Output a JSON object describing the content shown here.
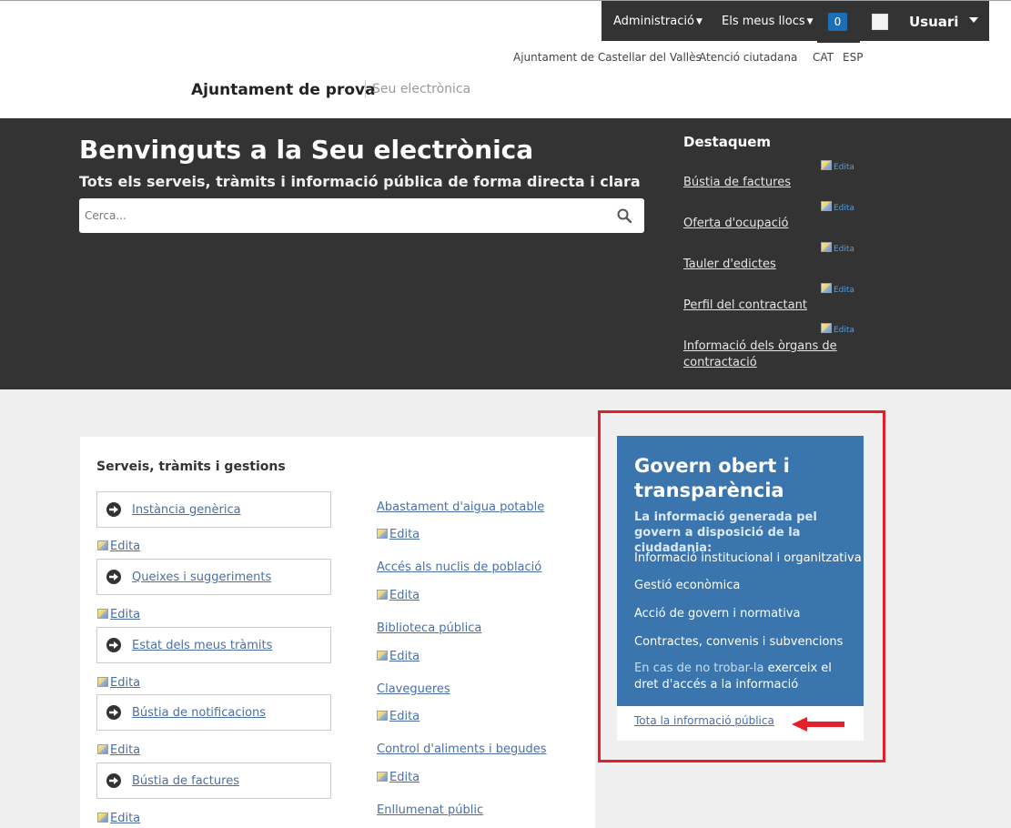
{
  "adminbar": {
    "admin_menu": "Administració",
    "sites_menu": "Els meus llocs",
    "notifications_count": "0",
    "user_name": "Usuari"
  },
  "toplinks": {
    "ajuntament": "Ajuntament de Castellar del Vallès",
    "atencio": "Atenció ciutadana",
    "lang_cat": "CAT",
    "lang_esp": "ESP"
  },
  "brand": {
    "name": "Ajuntament de prova",
    "sub": "Seu electrònica"
  },
  "hero": {
    "title": "Benvinguts a la Seu electrònica",
    "subtitle": "Tots els serveis, tràmits i informació pública de forma directa i clara",
    "search_placeholder": "Cerca..."
  },
  "destaquem": {
    "title": "Destaquem",
    "edit_label": "Edita",
    "items": [
      "Bústia de factures",
      "Oferta d'ocupació",
      "Tauler d'edictes",
      "Perfil del contractant",
      "Informació dels òrgans de contractació"
    ]
  },
  "serveis": {
    "title": "Serveis, tràmits i gestions",
    "edit_label": "Edita",
    "items": [
      "Instància genèrica",
      "Queixes i suggeriments",
      "Estat dels meus tràmits",
      "Bústia de notificacions",
      "Bústia de factures"
    ],
    "categories": [
      "Abastament d'aigua potable",
      "Accés als nuclis de població",
      "Biblioteca pública",
      "Clavegueres",
      "Control d'aliments i begudes",
      "Enllumenat públic"
    ]
  },
  "govern": {
    "title": "Govern obert i transparència",
    "intro": "La informació generada pel govern a disposició de la ciudadania:",
    "items": [
      "Informació institucional i organitzativa",
      "Gestió econòmica",
      "Acció de govern i normativa",
      "Contractes, convenis i subvencions"
    ],
    "note_muted": "En cas de no trobar-la",
    "note_bold": "exerceix el dret d'accés a la informació",
    "footer_link": "Tota la informació pública"
  },
  "colors": {
    "dark": "#333333",
    "accent_blue": "#3a75ad",
    "highlight_red": "#e51f2a",
    "badge_blue": "#1a6fb5"
  }
}
